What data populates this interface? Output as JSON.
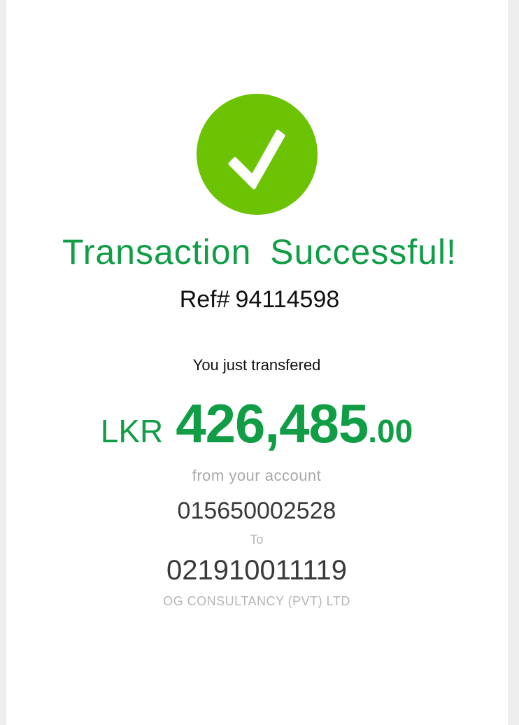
{
  "colors": {
    "success_green": "#109d46",
    "check_circle": "#6cc304",
    "card_bg": "#ffffff",
    "page_bg": "#eeeeee"
  },
  "status": {
    "icon": "checkmark-icon",
    "title": "Transaction  Successful!"
  },
  "reference": {
    "label": "Ref#",
    "number": "94114598"
  },
  "transfer": {
    "intro": "You just transfered",
    "currency": "LKR",
    "amount_main": "426,485",
    "amount_cents": ".00",
    "from_label": "from your account",
    "from_account": "015650002528",
    "to_label": "To",
    "to_account": "021910011119",
    "payee_name": "OG CONSULTANCY (PVT) LTD"
  }
}
